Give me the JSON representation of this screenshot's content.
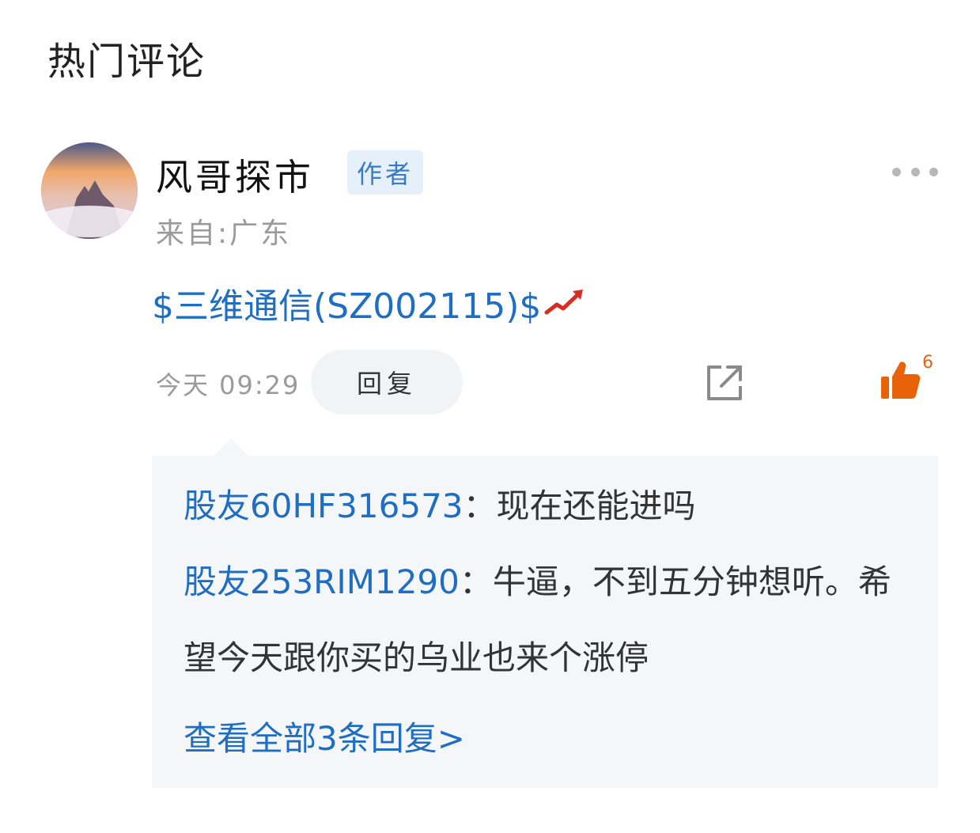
{
  "section": {
    "title": "热门评论"
  },
  "comment": {
    "author": "风哥探市",
    "badge": "作者",
    "location": "来自:广东",
    "stock_text": "$三维通信(SZ002115)$",
    "trend_icon": "rising-arrow-icon",
    "time": "今天 09:29",
    "reply_label": "回复",
    "like_count": "6",
    "colors": {
      "link": "#1f6ec2",
      "like": "#e8620a",
      "badge_bg": "#e5f0fb"
    }
  },
  "replies": [
    {
      "user": "股友60HF316573",
      "text": "：现在还能进吗"
    },
    {
      "user": "股友253RIM1290",
      "text": "：牛逼，不到五分钟想听。希望今天跟你买的乌业也来个涨停"
    }
  ],
  "view_all": "查看全部3条回复>"
}
